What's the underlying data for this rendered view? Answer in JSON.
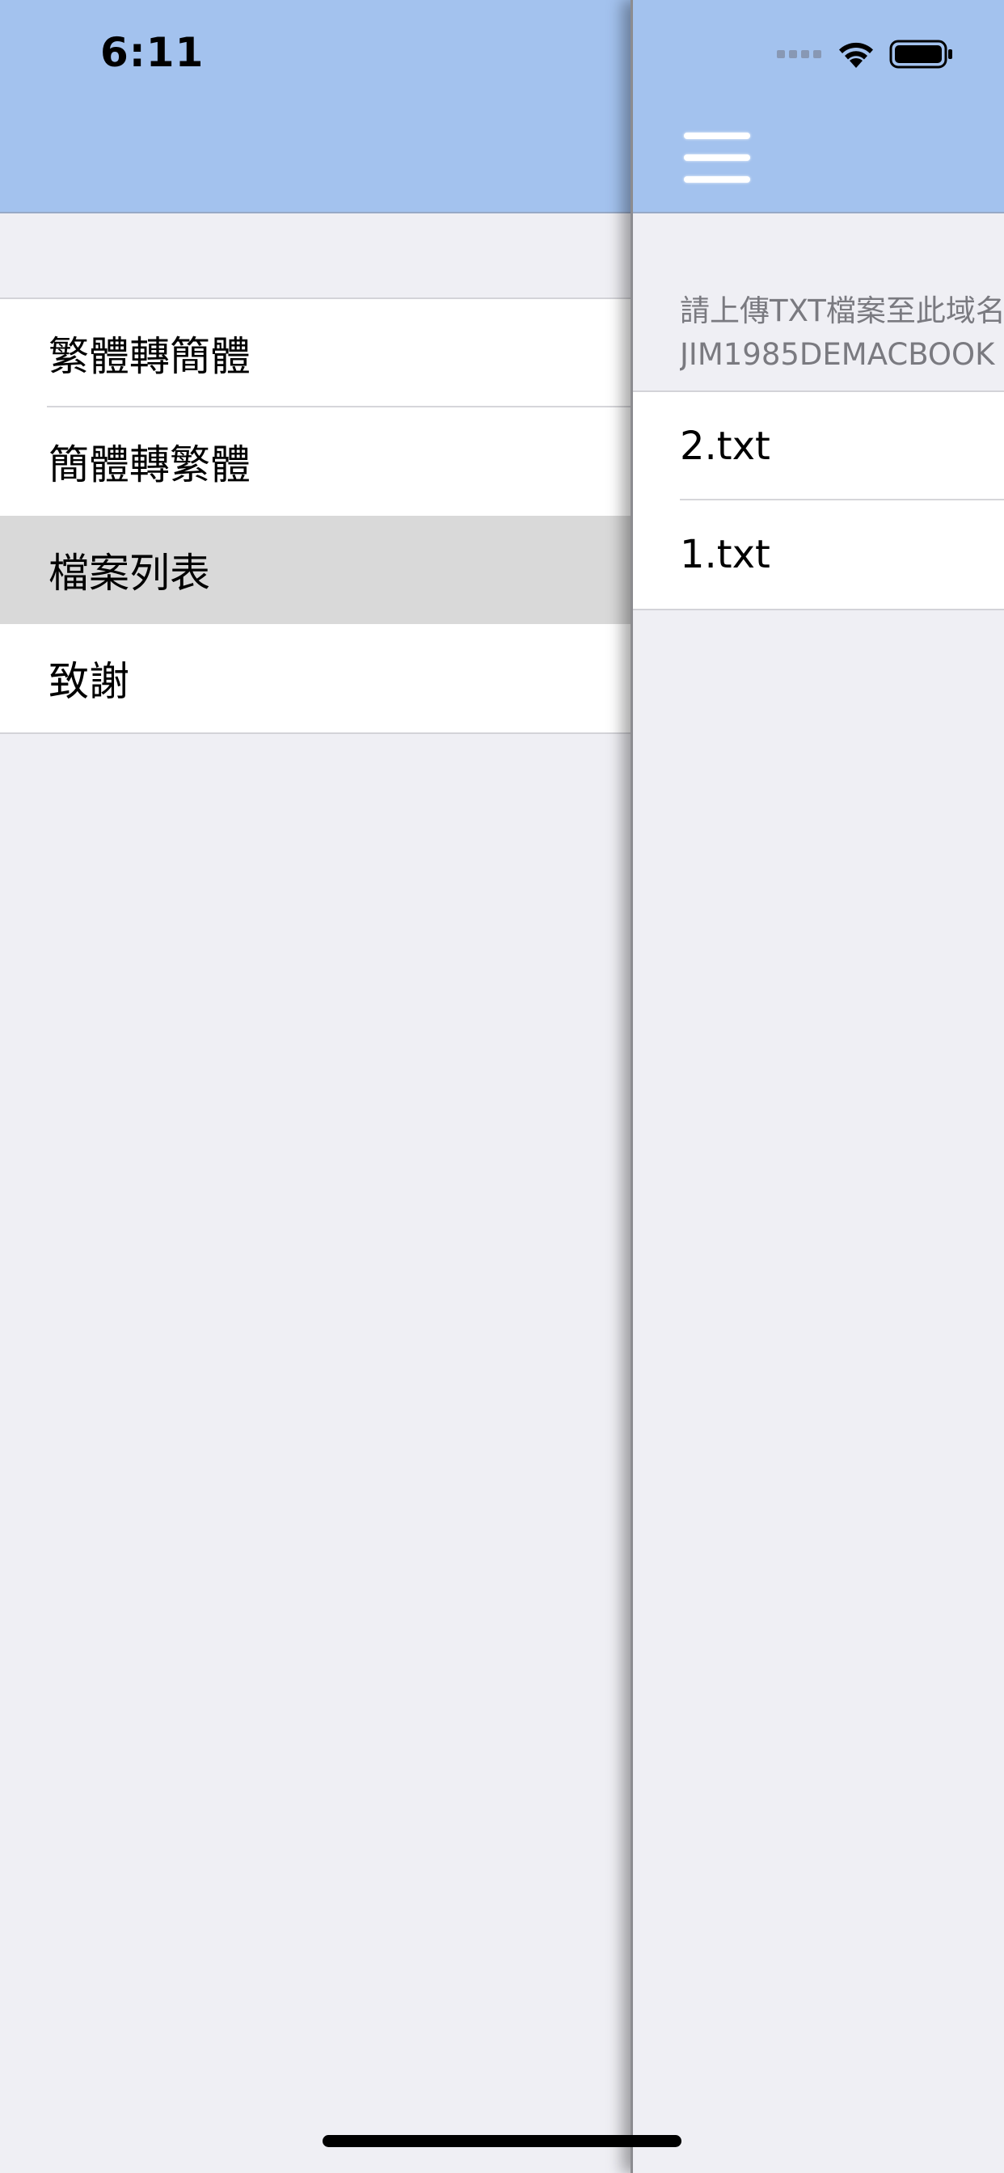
{
  "status_bar": {
    "time": "6:11"
  },
  "menu": {
    "items": [
      {
        "label": "繁體轉簡體"
      },
      {
        "label": "簡體轉繁體"
      },
      {
        "label": "檔案列表",
        "selected": true
      },
      {
        "label": "致謝"
      }
    ]
  },
  "content": {
    "hint_line1": "請上傳TXT檔案至此域名",
    "hint_line2": "JIM1985DEMACBOOK",
    "files": [
      {
        "name": "2.txt"
      },
      {
        "name": "1.txt"
      }
    ]
  },
  "icons": {
    "menu": "hamburger-menu-icon",
    "wifi": "wifi-icon",
    "battery": "battery-icon",
    "signal": "cellular-signal-icon"
  },
  "colors": {
    "nav_bar": "#a3c2ee",
    "background": "#efeff4",
    "selected_row": "#d9d9d9"
  }
}
